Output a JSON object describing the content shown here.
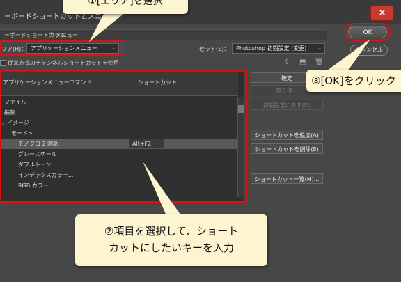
{
  "window": {
    "title": "ーボードショートカットとメニュー",
    "close_label": "✕"
  },
  "tabs": [
    {
      "label": "ーボードショートカット"
    },
    {
      "label": "メニュー"
    }
  ],
  "area": {
    "label": "リア(H)：",
    "value": "アプリケーションメニュー"
  },
  "set": {
    "label": "セット(S)：",
    "value": "Photoshop 初期設定 (変更)"
  },
  "legacy_channel": {
    "label": "従来方式のチャンネルショートカットを使用",
    "checked": false
  },
  "list": {
    "col_command": "アプリケーションメニューコマンド",
    "col_shortcut": "ショートカット",
    "rows": [
      {
        "label": "ファイル",
        "shortcut": ""
      },
      {
        "label": "編集",
        "shortcut": ""
      },
      {
        "label": "イメージ",
        "shortcut": ""
      },
      {
        "label": "モード>",
        "shortcut": ""
      },
      {
        "label": "モノクロ 2 階調",
        "shortcut": "Alt+F2",
        "selected": true
      },
      {
        "label": "グレースケール",
        "shortcut": ""
      },
      {
        "label": "ダブルトーン",
        "shortcut": ""
      },
      {
        "label": "インデックスカラー...",
        "shortcut": ""
      },
      {
        "label": "RGB カラー",
        "shortcut": ""
      }
    ]
  },
  "side_buttons": {
    "accept": "確定",
    "undo": "取り消し",
    "use_default": "初期設定に戻す(D)",
    "add": "ショートカットを追加(A)",
    "delete": "ショートカットを削除(E)",
    "summarize": "ショートカット一覧(M)..."
  },
  "dialog_buttons": {
    "ok": "OK",
    "cancel": "キャンセル"
  },
  "callouts": {
    "step1": "①[エリア]を選択",
    "step2_line1": "②項目を選択して、ショート",
    "step2_line2": "カットにしたいキーを入力",
    "step3": "③[OK]をクリック"
  },
  "colors": {
    "highlight_red": "#dd1111",
    "callout_bg": "#fdf5cf",
    "close_red": "#c73a30"
  }
}
